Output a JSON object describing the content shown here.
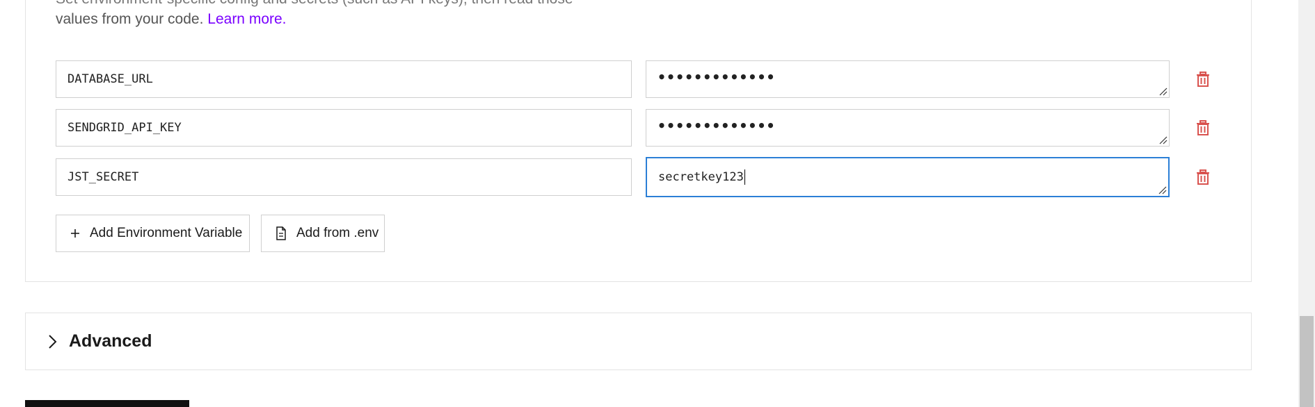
{
  "description": {
    "line1": "Set environment-specific config and secrets (such as API keys), then read those",
    "line2_prefix": "values from your code.",
    "learn_more": "Learn more."
  },
  "env_vars": [
    {
      "key": "DATABASE_URL",
      "value_masked": "•••••••••••••"
    },
    {
      "key": "SENDGRID_API_KEY",
      "value_masked": "•••••••••••••"
    },
    {
      "key": "JST_SECRET",
      "value": "secretkey123"
    }
  ],
  "buttons": {
    "add_env_var": "Add Environment Variable",
    "add_from_env": "Add from .env"
  },
  "advanced": {
    "title": "Advanced"
  },
  "icons": {
    "trash": "trash-icon",
    "plus": "plus-icon",
    "file": "file-icon",
    "chevron": "chevron-right-icon"
  },
  "colors": {
    "link": "#7a00ff",
    "focus": "#2b7fd6",
    "danger": "#d9534f"
  }
}
